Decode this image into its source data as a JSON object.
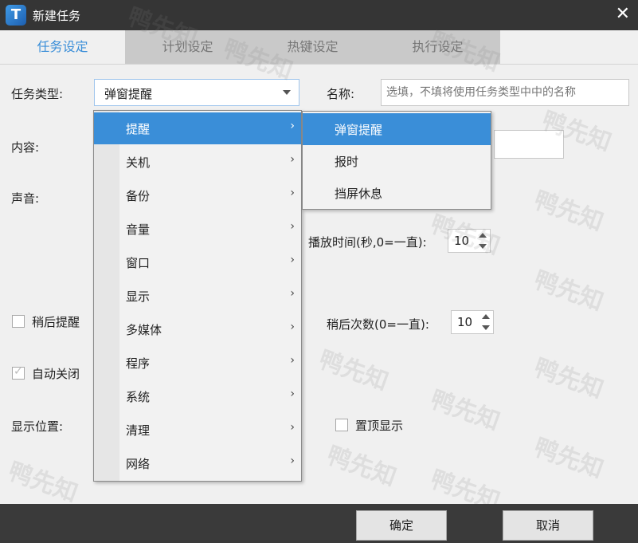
{
  "window": {
    "title": "新建任务",
    "logo": "T",
    "close": "✕"
  },
  "tabs": [
    {
      "label": "任务设定",
      "active": true
    },
    {
      "label": "计划设定",
      "active": false
    },
    {
      "label": "热键设定",
      "active": false
    },
    {
      "label": "执行设定",
      "active": false
    }
  ],
  "form": {
    "task_type_label": "任务类型:",
    "task_type_value": "弹窗提醒",
    "name_label": "名称:",
    "name_placeholder": "选填，不填将使用任务类型中中的名称",
    "content_label": "内容:",
    "sound_label": "声音:",
    "play_time_label": "播放时间(秒,0=一直):",
    "play_time_value": "10",
    "snooze_label": "稍后提醒",
    "snooze_count_label": "稍后次数(0=一直):",
    "snooze_count_value": "10",
    "auto_close_label": "自动关闭",
    "position_label": "显示位置:",
    "on_top_label": "置顶显示"
  },
  "menu": {
    "items": [
      {
        "label": "提醒",
        "arrow": "›"
      },
      {
        "label": "关机",
        "arrow": "›"
      },
      {
        "label": "备份",
        "arrow": "›"
      },
      {
        "label": "音量",
        "arrow": "›"
      },
      {
        "label": "窗口",
        "arrow": "›"
      },
      {
        "label": "显示",
        "arrow": "›"
      },
      {
        "label": "多媒体",
        "arrow": "›"
      },
      {
        "label": "程序",
        "arrow": "›"
      },
      {
        "label": "系统",
        "arrow": "›"
      },
      {
        "label": "清理",
        "arrow": "›"
      },
      {
        "label": "网络",
        "arrow": "›"
      }
    ],
    "highlighted_index": 0
  },
  "submenu": {
    "items": [
      {
        "label": "弹窗提醒"
      },
      {
        "label": "报时"
      },
      {
        "label": "挡屏休息"
      }
    ],
    "highlighted_index": 0
  },
  "buttons": {
    "ok": "确定",
    "cancel": "取消"
  },
  "watermark": "鸭先知",
  "colors": {
    "accent": "#3a8ed8",
    "titlebar": "#353535",
    "footer": "#3a3a3a"
  }
}
